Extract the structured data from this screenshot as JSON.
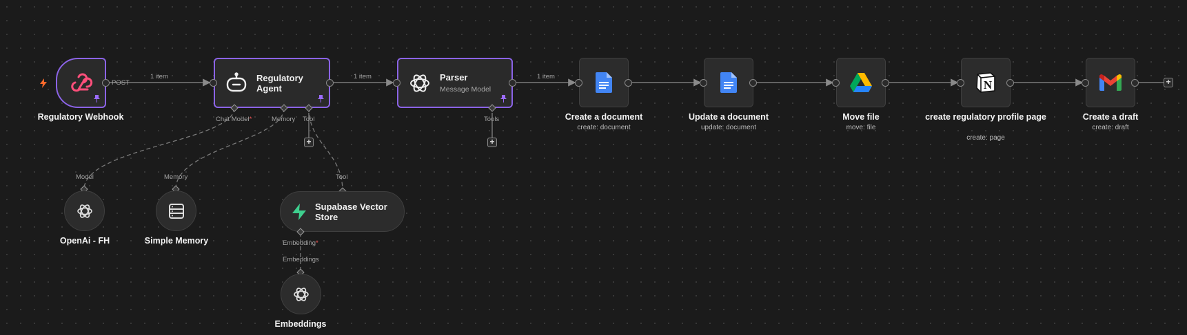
{
  "canvas": {
    "accent": "#8b63e6",
    "background": "#1b1b1b"
  },
  "nodes": {
    "webhook": {
      "title": "Regulatory Webhook",
      "output_label": "POST",
      "icon": "webhook-icon",
      "trigger_icon": "lightning-icon"
    },
    "agent": {
      "title": "Regulatory Agent",
      "icon": "robot-icon",
      "chat_model_label": "Chat Model",
      "chat_model_required": "*",
      "memory_label": "Memory",
      "tool_label": "Tool"
    },
    "parser": {
      "title": "Parser",
      "subtitle": "Message Model",
      "icon": "openai-icon",
      "tools_label": "Tools"
    },
    "create_doc": {
      "title": "Create a document",
      "subtitle": "create: document",
      "icon": "google-docs-icon"
    },
    "update_doc": {
      "title": "Update a document",
      "subtitle": "update: document",
      "icon": "google-docs-icon"
    },
    "move_file": {
      "title": "Move file",
      "subtitle": "move: file",
      "icon": "google-drive-icon"
    },
    "notion": {
      "title": "create regulatory profile page",
      "subtitle": "create: page",
      "icon": "notion-icon"
    },
    "gmail": {
      "title": "Create a draft",
      "subtitle": "create: draft",
      "icon": "gmail-icon"
    },
    "openai": {
      "title": "OpenAi - FH",
      "input_label": "Model",
      "icon": "openai-icon"
    },
    "memory": {
      "title": "Simple Memory",
      "input_label": "Memory",
      "icon": "database-icon"
    },
    "supabase": {
      "title": "Supabase Vector Store",
      "input_label": "Tool",
      "embedding_label": "Embedding",
      "embedding_required": "*",
      "icon": "supabase-icon"
    },
    "embeddings": {
      "title": "Embeddings",
      "input_label": "Embeddings",
      "icon": "openai-icon"
    }
  },
  "edges": {
    "webhook_to_agent": "1 item",
    "agent_to_parser": "1 item",
    "parser_to_create": "1 item"
  }
}
